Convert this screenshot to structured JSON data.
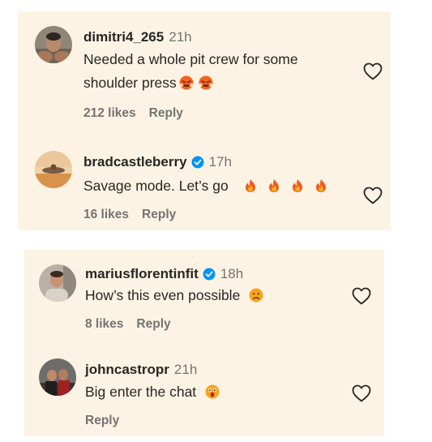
{
  "comments": [
    {
      "username": "dimitri4_265",
      "time": "21h",
      "verified": false,
      "text_line1": "Needed a whole pit crew for some",
      "text_line2": "shoulder press",
      "emojis": [
        "face-with-steam-emoji",
        "face-with-steam-emoji"
      ],
      "likes": "212 likes",
      "reply": "Reply"
    },
    {
      "username": "bradcastleberry",
      "time": "17h",
      "verified": true,
      "text": "Savage mode. Let’s go",
      "emojis": [
        "fire-emoji",
        "fire-emoji",
        "fire-emoji",
        "fire-emoji"
      ],
      "likes": "16 likes",
      "reply": "Reply"
    },
    {
      "username": "mariusflorentinfit",
      "time": "18h",
      "verified": true,
      "text": "How’s this even possible",
      "emojis": [
        "frowning-face-emoji"
      ],
      "likes": "8 likes",
      "reply": "Reply"
    },
    {
      "username": "johncastropr",
      "time": "21h",
      "verified": false,
      "text": "Big enter the chat",
      "emojis": [
        "astonished-face-emoji"
      ],
      "likes": "",
      "reply": "Reply"
    }
  ],
  "colors": {
    "panel_bg": "#fdf3e4",
    "text": "#262626",
    "muted": "#737373",
    "verified_blue": "#0095f6"
  },
  "icons": {
    "like": "heart-outline-icon",
    "verified": "verified-badge-icon"
  }
}
